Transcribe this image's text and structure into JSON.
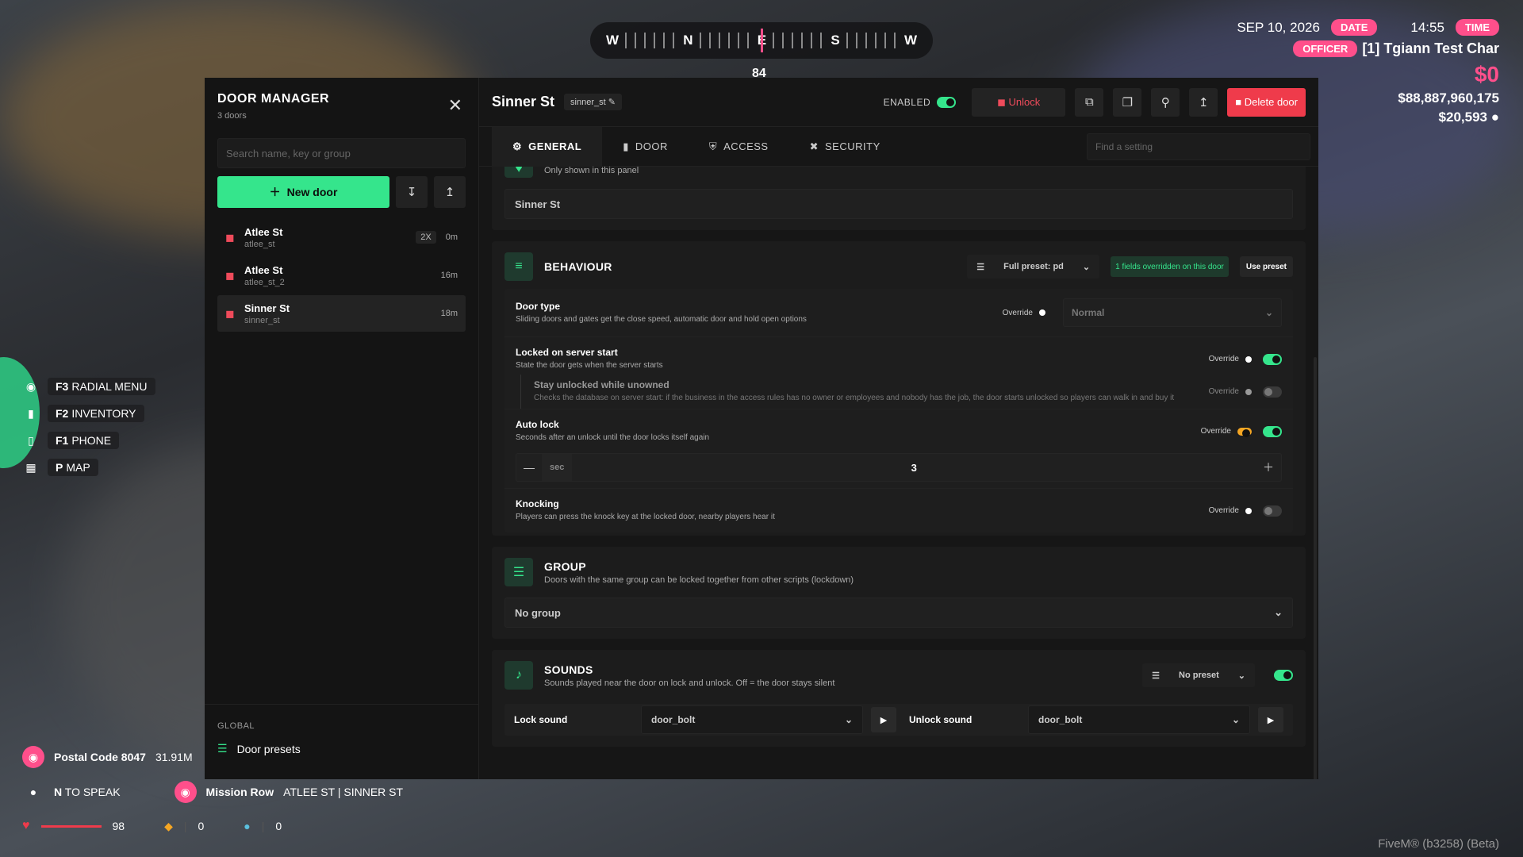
{
  "hud": {
    "compass": {
      "w1": "W",
      "n": "N",
      "e": "E",
      "s": "S",
      "w2": "W",
      "degrees": "84"
    },
    "date": "SEP 10, 2026",
    "date_label": "DATE",
    "time": "14:55",
    "time_label": "TIME",
    "role": "OFFICER",
    "player": "[1] Tgiann Test Char",
    "cash": "$0",
    "bank": "$88,887,960,175",
    "dirty": "$20,593",
    "hotkeys": [
      {
        "key": "F3",
        "label": "RADIAL MENU"
      },
      {
        "key": "F2",
        "label": "INVENTORY"
      },
      {
        "key": "F1",
        "label": "PHONE"
      },
      {
        "key": "P",
        "label": "MAP"
      }
    ],
    "postal": "Postal Code 8047",
    "postal_dist": "31.91M",
    "speak_key": "N",
    "speak_label": "TO SPEAK",
    "location_main": "Mission Row",
    "location_sub": "ATLEE ST | SINNER ST",
    "health": "98",
    "armor": "0",
    "thirst": "0",
    "fivem": "FiveM® (b3258) (Beta)"
  },
  "manager": {
    "title": "DOOR MANAGER",
    "count": "3 doors",
    "search_placeholder": "Search name, key or group",
    "new_door": "New door",
    "doors": [
      {
        "name": "Atlee St",
        "key": "atlee_st",
        "badge": "2X",
        "time": "0m"
      },
      {
        "name": "Atlee St",
        "key": "atlee_st_2",
        "badge": "",
        "time": "16m"
      },
      {
        "name": "Sinner St",
        "key": "sinner_st",
        "badge": "",
        "time": "18m"
      }
    ],
    "global_label": "GLOBAL",
    "door_presets": "Door presets"
  },
  "detail": {
    "title": "Sinner St",
    "key": "sinner_st",
    "enabled_label": "ENABLED",
    "unlock": "Unlock",
    "delete": "Delete door",
    "tabs": [
      "GENERAL",
      "DOOR",
      "ACCESS",
      "SECURITY"
    ],
    "find_placeholder": "Find a setting",
    "name_card": {
      "sub": "Only shown in this panel",
      "value": "Sinner St"
    },
    "behaviour": {
      "title": "BEHAVIOUR",
      "preset": "Full preset: pd",
      "note": "1 fields overridden on this door",
      "use_preset": "Use preset",
      "override": "Override",
      "door_type": {
        "title": "Door type",
        "desc": "Sliding doors and gates get the close speed, automatic door and hold open options",
        "value": "Normal"
      },
      "locked_start": {
        "title": "Locked on server start",
        "desc": "State the door gets when the server starts"
      },
      "stay_unlocked": {
        "title": "Stay unlocked while unowned",
        "desc": "Checks the database on server start: if the business in the access rules has no owner or employees and nobody has the job, the door starts unlocked so players can walk in and buy it"
      },
      "auto_lock": {
        "title": "Auto lock",
        "desc": "Seconds after an unlock until the door locks itself again",
        "unit": "sec",
        "value": "3"
      },
      "knocking": {
        "title": "Knocking",
        "desc": "Players can press the knock key at the locked door, nearby players hear it"
      }
    },
    "group": {
      "title": "GROUP",
      "desc": "Doors with the same group can be locked together from other scripts (lockdown)",
      "value": "No group"
    },
    "sounds": {
      "title": "SOUNDS",
      "desc": "Sounds played near the door on lock and unlock. Off = the door stays silent",
      "preset": "No preset",
      "lock_label": "Lock sound",
      "lock_value": "door_bolt",
      "unlock_label": "Unlock sound",
      "unlock_value": "door_bolt"
    }
  }
}
